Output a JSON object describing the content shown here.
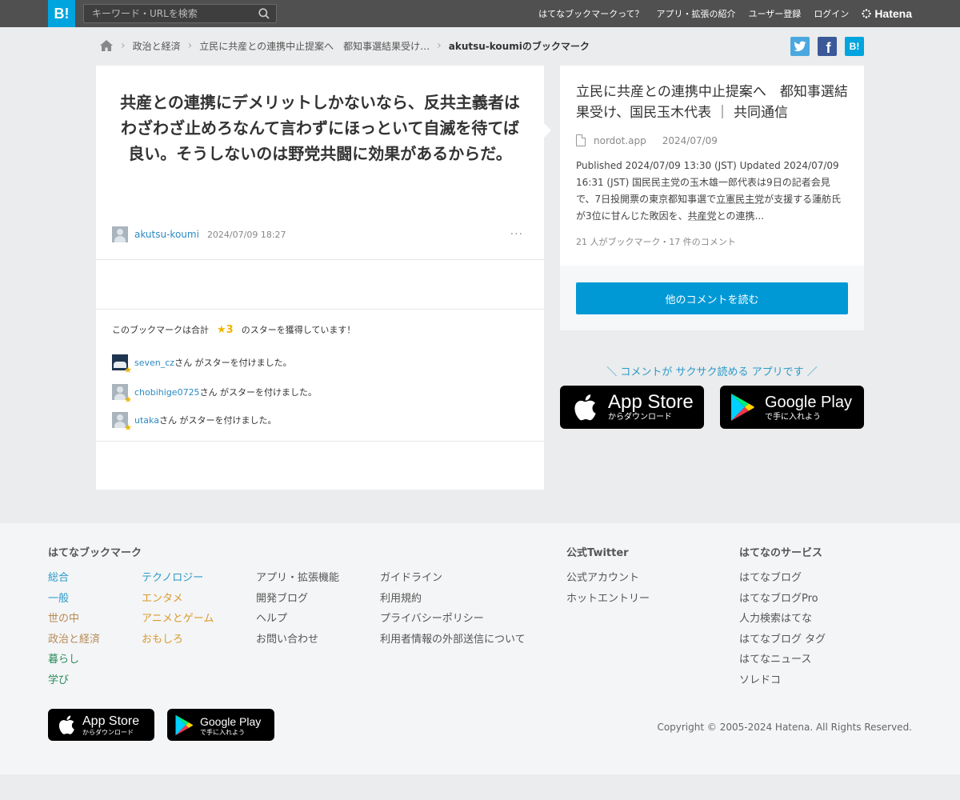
{
  "header": {
    "logo": "B!",
    "search_placeholder": "キーワード・URLを検索",
    "nav": [
      "はてなブックマークって？",
      "アプリ・拡張の紹介",
      "ユーザー登録",
      "ログイン"
    ],
    "brand": "Hatena"
  },
  "breadcrumb": {
    "items": [
      "政治と経済",
      "立民に共産との連携中止提案へ　都知事選結果受け…"
    ],
    "current": "akutsu-koumiのブックマーク"
  },
  "share": {
    "twitter_color": "#4ba8df",
    "facebook_color": "#3b5998",
    "hatena_color": "#00a4de",
    "hatena_label": "B!"
  },
  "bookmark": {
    "comment": "共産との連携にデメリットしかないなら、反共主義者はわざわざ止めろなんて言わずにほっといて自滅を待てば良い。そうしないのは野党共闘に効果があるからだ。",
    "user": "akutsu-koumi",
    "date": "2024/07/09 18:27",
    "more": "···",
    "stars": {
      "prefix": "このブックマークは合計",
      "count": "★3",
      "suffix": "のスターを獲得しています！",
      "users": [
        {
          "name": "seven_cz",
          "text": "さん がスターを付けました。"
        },
        {
          "name": "chobihige0725",
          "text": "さん がスターを付けました。"
        },
        {
          "name": "utaka",
          "text": "さん がスターを付けました。"
        }
      ]
    }
  },
  "entry": {
    "title": "立民に共産との連携中止提案へ　都知事選結果受け、国民玉木代表 ｜ 共同通信",
    "site": "nordot.app",
    "date": "2024/07/09",
    "summary_1": "Published 2024/07/09 13:30 (JST) Updated 2024/07/09 16:31 (JST) 国民民主党の玉木雄一郎代表は9日の記者会見で、7日投開票の東京都知事選で",
    "summary_link_1": "立憲民主党",
    "summary_2": "が支援する蓮舫氏が3位に甘んじた敗因を、",
    "summary_link_2": "共産党",
    "summary_3": "との連携...",
    "counts": "21 人がブックマーク・17 件のコメント",
    "read_button": "他のコメントを読む"
  },
  "app_promo": "＼ コメントが サクサク読める アプリです ／",
  "badges": {
    "appstore_main": "App Store",
    "appstore_sub": "からダウンロード",
    "googleplay_main": "Google Play",
    "googleplay_sub": "で手に入れよう"
  },
  "footer": {
    "bookmark_heading": "はてなブックマーク",
    "cat_col1": [
      "総合",
      "一般",
      "世の中",
      "政治と経済",
      "暮らし",
      "学び"
    ],
    "cat_col2": [
      "テクノロジー",
      "エンタメ",
      "アニメとゲーム",
      "おもしろ"
    ],
    "links_col3": [
      "アプリ・拡張機能",
      "開発ブログ",
      "ヘルプ",
      "お問い合わせ"
    ],
    "links_col4": [
      "ガイドライン",
      "利用規約",
      "プライバシーポリシー",
      "利用者情報の外部送信について"
    ],
    "twitter_heading": "公式Twitter",
    "twitter_links": [
      "公式アカウント",
      "ホットエントリー"
    ],
    "services_heading": "はてなのサービス",
    "services": [
      "はてなブログ",
      "はてなブログPro",
      "人力検索はてな",
      "はてなブログ タグ",
      "はてなニュース",
      "ソレドコ"
    ],
    "copyright": "Copyright © 2005-2024 Hatena. All Rights Reserved."
  }
}
